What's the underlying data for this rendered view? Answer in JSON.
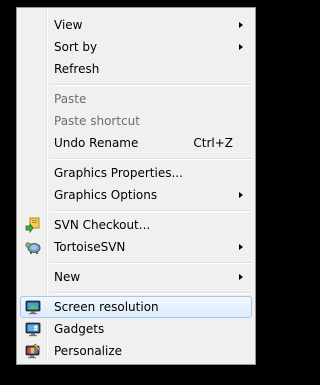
{
  "menu": {
    "items": [
      {
        "label": "View",
        "has_submenu": true
      },
      {
        "label": "Sort by",
        "has_submenu": true
      },
      {
        "label": "Refresh"
      },
      {
        "label": "Paste",
        "disabled": true
      },
      {
        "label": "Paste shortcut",
        "disabled": true
      },
      {
        "label": "Undo Rename",
        "shortcut": "Ctrl+Z"
      },
      {
        "label": "Graphics Properties..."
      },
      {
        "label": "Graphics Options",
        "has_submenu": true
      },
      {
        "label": "SVN Checkout...",
        "icon": "svn-checkout-icon"
      },
      {
        "label": "TortoiseSVN",
        "icon": "tortoisesvn-icon",
        "has_submenu": true
      },
      {
        "label": "New",
        "has_submenu": true
      },
      {
        "label": "Screen resolution",
        "icon": "screen-resolution-icon",
        "highlighted": true
      },
      {
        "label": "Gadgets",
        "icon": "gadgets-icon"
      },
      {
        "label": "Personalize",
        "icon": "personalize-icon"
      }
    ]
  },
  "colors": {
    "menu_background": "#f0f0f0",
    "disabled_text": "#6d6d6d",
    "highlight_border": "#a7c7ee"
  }
}
